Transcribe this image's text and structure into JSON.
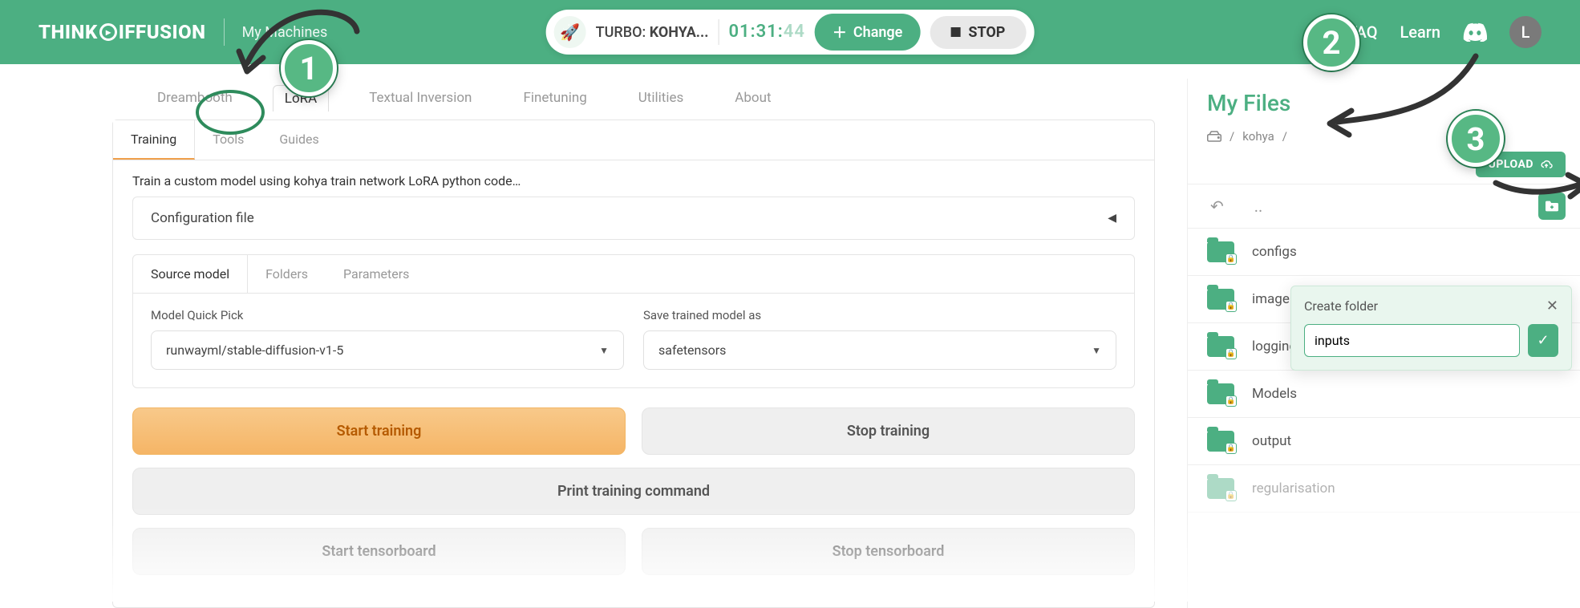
{
  "header": {
    "brand_left": "THINK",
    "brand_mid": "D",
    "brand_right": "IFFUSION",
    "my_machines": "My Machines",
    "faq": "FAQ",
    "learn": "Learn",
    "avatar_letter": "L"
  },
  "pill": {
    "prefix": "TURBO: ",
    "name": "KOHYA...",
    "time_main": "01:31:",
    "time_fade": "44",
    "change": "Change",
    "stop": "STOP"
  },
  "main_tabs": [
    "Dreambooth",
    "LoRA",
    "Textual Inversion",
    "Finetuning",
    "Utilities",
    "About"
  ],
  "main_tab_active": 1,
  "sub_tabs": [
    "Training",
    "Tools",
    "Guides"
  ],
  "sub_tab_active": 0,
  "description": "Train a custom model using kohya train network LoRA python code…",
  "config_label": "Configuration file",
  "sm_tabs": [
    "Source model",
    "Folders",
    "Parameters"
  ],
  "sm_tab_active": 0,
  "model_pick_label": "Model Quick Pick",
  "model_pick_value": "runwayml/stable-diffusion-v1-5",
  "save_as_label": "Save trained model as",
  "save_as_value": "safetensors",
  "buttons": {
    "start_training": "Start training",
    "stop_training": "Stop training",
    "print_cmd": "Print training command",
    "start_tb": "Start tensorboard",
    "stop_tb": "Stop tensorboard"
  },
  "files": {
    "title": "My Files",
    "crumb": "kohya",
    "upload": "UPLOAD",
    "back": "..",
    "folders": [
      "configs",
      "image",
      "logging",
      "Models",
      "output",
      "regularisation"
    ],
    "create_label": "Create folder",
    "create_value": "inputs"
  },
  "annotations": {
    "one": "1",
    "two": "2",
    "three": "3"
  }
}
